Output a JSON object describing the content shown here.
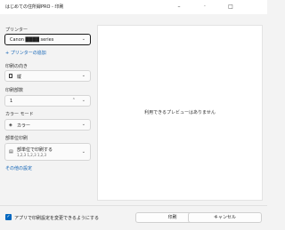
{
  "window": {
    "title": "はじめての住所録PRO - 印刷",
    "minimize_glyph": "–",
    "maximize_glyph": "□"
  },
  "printer": {
    "label": "プリンター",
    "value": "Canon ████ series",
    "add_link": "+ プリンターの追加"
  },
  "orientation": {
    "label": "印刷の向き",
    "value": "縦"
  },
  "copies": {
    "label": "印刷部数",
    "value": "1"
  },
  "color_mode": {
    "label": "カラー モード",
    "value": "カラー"
  },
  "collate": {
    "label": "部単位印刷",
    "value_line1": "部単位で印刷する",
    "value_line2": "1,2,3   1,2,3   1,2,3"
  },
  "other_settings_link": "その他の設定",
  "preview": {
    "message": "利用できるプレビューはありません"
  },
  "footer": {
    "checkbox_label": "アプリで印刷設定を変更できるようにする",
    "print_button": "印刷",
    "cancel_button": "キャンセル"
  }
}
